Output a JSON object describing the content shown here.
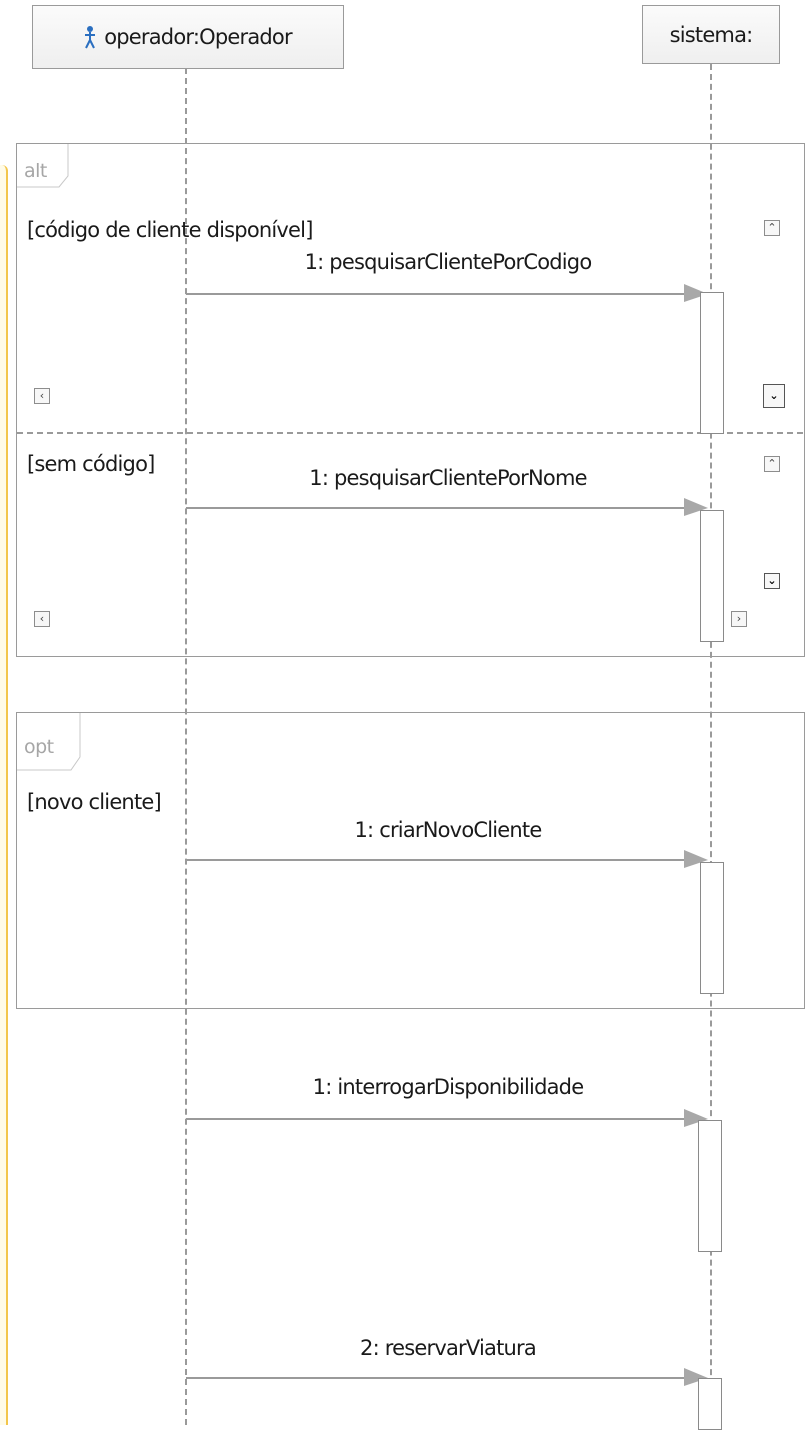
{
  "lifelines": [
    {
      "id": "operador",
      "label": "operador:Operador",
      "icon": "actor-icon"
    },
    {
      "id": "sistema",
      "label": "sistema:"
    }
  ],
  "fragments": [
    {
      "operator": "alt",
      "operands": [
        {
          "guard": "[código de cliente disponível]",
          "message": "1: pesquisarClientePorCodigo"
        },
        {
          "guard": "[sem código]",
          "message": "1: pesquisarClientePorNome"
        }
      ]
    },
    {
      "operator": "opt",
      "operands": [
        {
          "guard": "[novo cliente]",
          "message": "1: criarNovoCliente"
        }
      ]
    }
  ],
  "messages": [
    {
      "label": "1: interrogarDisponibilidade"
    },
    {
      "label": "2: reservarViatura"
    }
  ],
  "colors": {
    "lines": "#9a9a9a",
    "actor_icon": "#2b6fc0",
    "side_border": "#f3c64b"
  }
}
